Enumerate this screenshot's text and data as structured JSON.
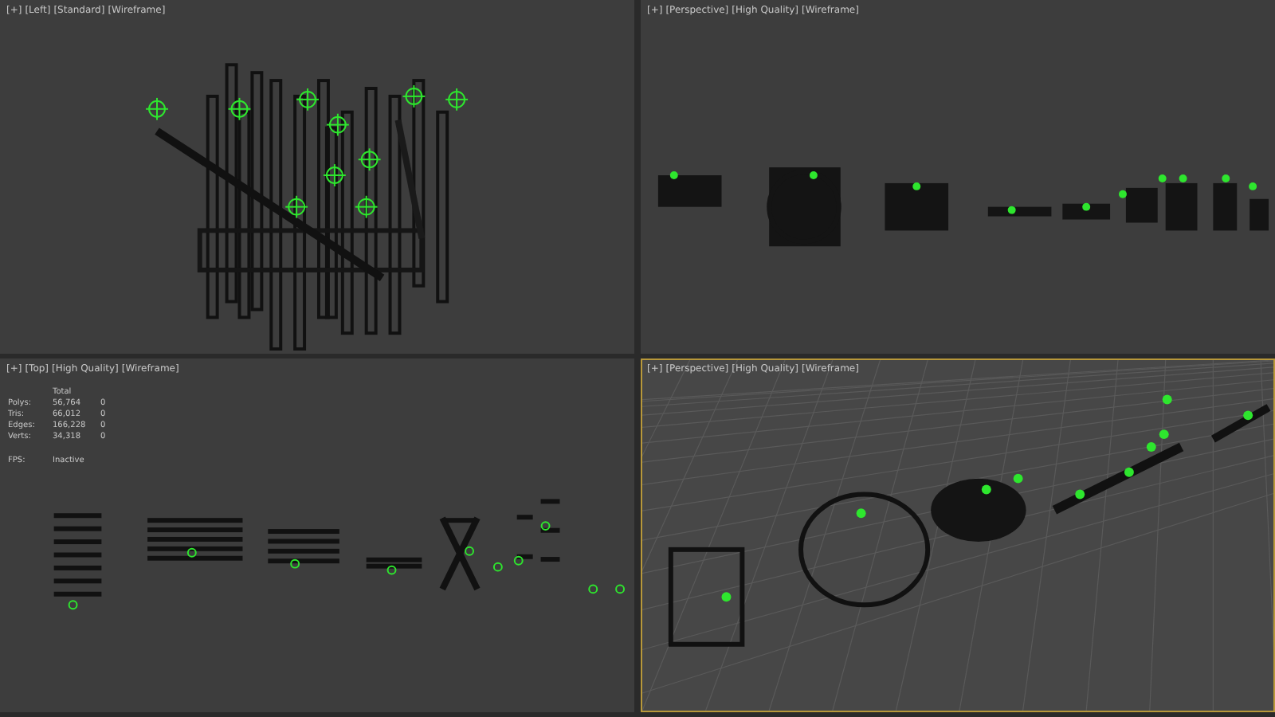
{
  "viewports": [
    {
      "kind": "side",
      "selected": false,
      "label": [
        "[+]",
        "[Left]",
        "[Standard]",
        "[Wireframe]"
      ]
    },
    {
      "kind": "front",
      "selected": false,
      "label": [
        "[+]",
        "[Perspective]",
        "[High Quality]",
        "[Wireframe]"
      ]
    },
    {
      "kind": "top",
      "selected": false,
      "label": [
        "[+]",
        "[Top]",
        "[High Quality]",
        "[Wireframe]"
      ],
      "stats": {
        "header": "Total",
        "fps_label": "FPS:",
        "fps_value": "Inactive",
        "rows": [
          {
            "name": "Polys:",
            "total": "56,764",
            "selection": "0"
          },
          {
            "name": "Tris:",
            "total": "66,012",
            "selection": "0"
          },
          {
            "name": "Edges:",
            "total": "166,228",
            "selection": "0"
          },
          {
            "name": "Verts:",
            "total": "34,318",
            "selection": "0"
          }
        ]
      }
    },
    {
      "kind": "camera",
      "selected": true,
      "label": [
        "[+]",
        "[Perspective]",
        "[High Quality]",
        "[Wireframe]"
      ]
    }
  ]
}
